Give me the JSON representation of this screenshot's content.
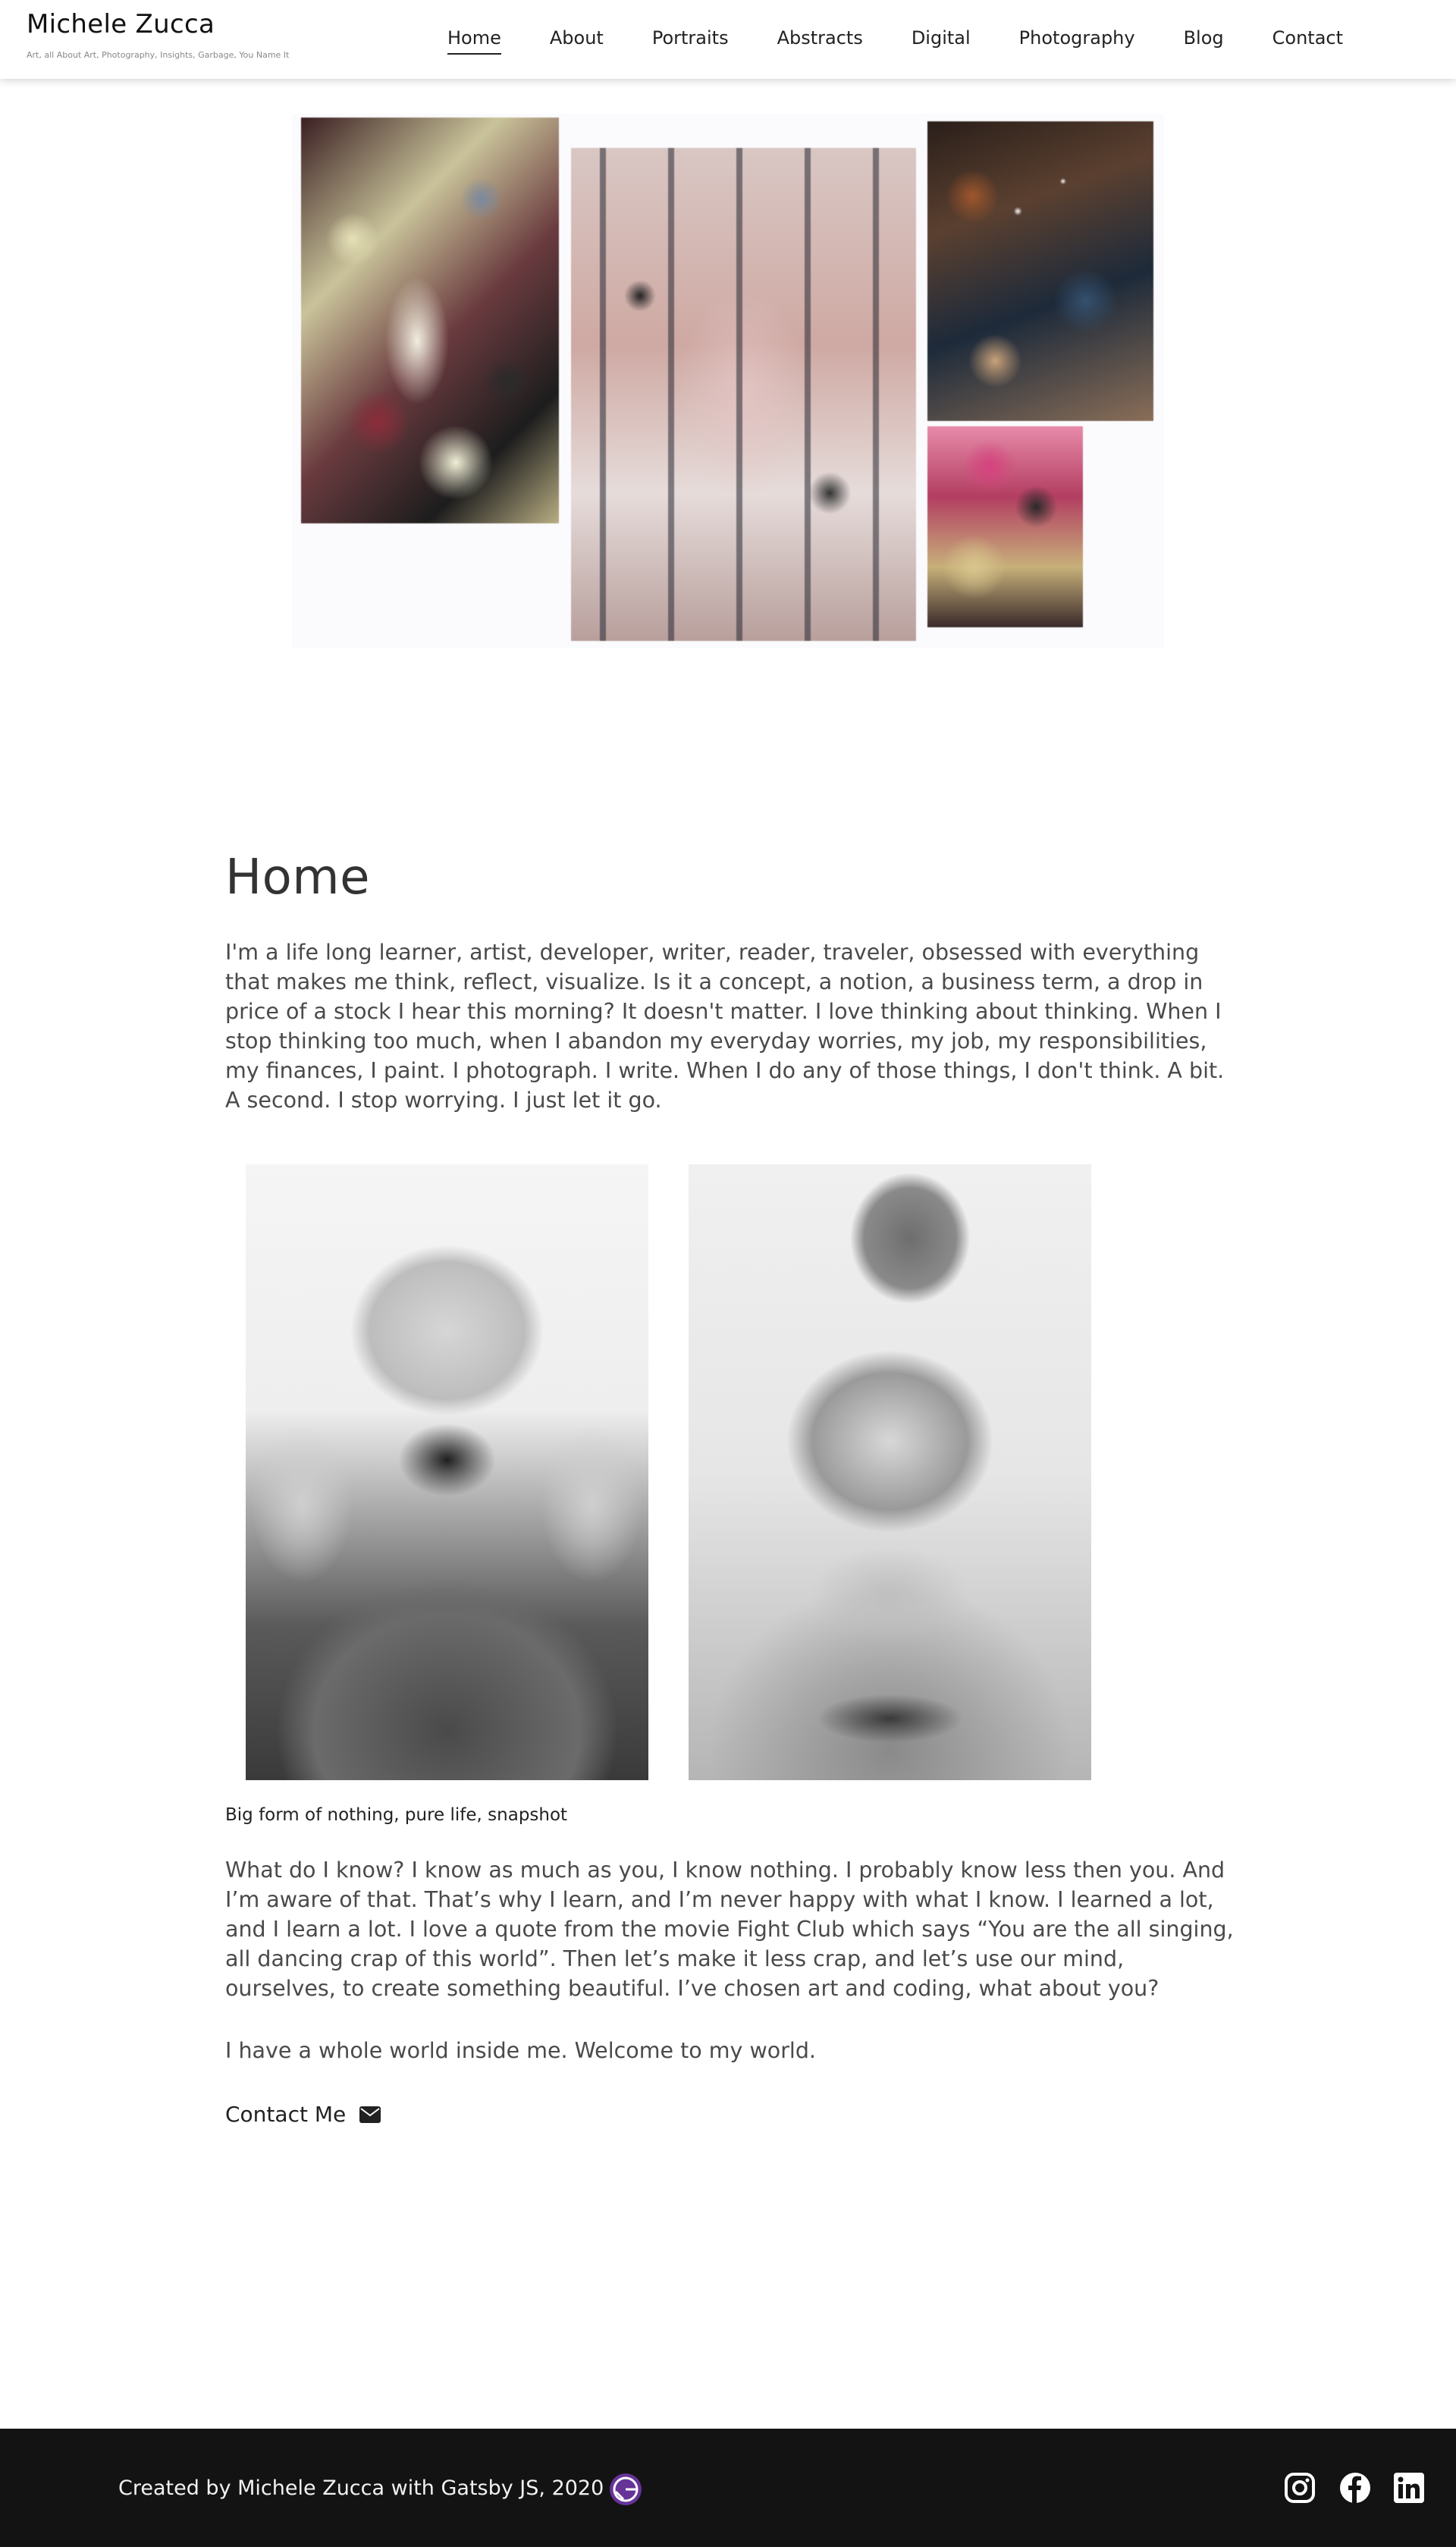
{
  "site": {
    "title": "Michele Zucca",
    "tagline": "Art, all About Art, Photography, Insights, Garbage, You Name It"
  },
  "nav": {
    "items": [
      {
        "label": "Home",
        "active": true
      },
      {
        "label": "About",
        "active": false
      },
      {
        "label": "Portraits",
        "active": false
      },
      {
        "label": "Abstracts",
        "active": false
      },
      {
        "label": "Digital",
        "active": false
      },
      {
        "label": "Photography",
        "active": false
      },
      {
        "label": "Blog",
        "active": false
      },
      {
        "label": "Contact",
        "active": false
      }
    ]
  },
  "main": {
    "title": "Home",
    "intro": "I'm a life long learner, artist, developer, writer, reader, traveler, obsessed with everything that makes me think, reflect, visualize. Is it a concept, a notion, a business term, a drop in price of a stock I hear this morning? It doesn't matter. I love thinking about thinking. When I stop thinking too much, when I abandon my everyday worries, my job, my responsibilities, my finances, I paint. I photograph. I write. When I do any of those things, I don't think. A bit. A second. I stop worrying. I just let it go.",
    "photo_caption": "Big form of nothing, pure life, snapshot",
    "body": "What do I know? I know as much as you, I know nothing. I probably know less then you. And I’m aware of that. That’s why I learn, and I’m never happy with what I know. I learned a lot, and I learn a lot. I love a quote from the movie Fight Club which says “You are the all singing, all dancing crap of this world”. Then let’s make it less crap, and let’s use our mind, ourselves, to create something beautiful. I’ve chosen art and coding, what about you?",
    "closing": "I have a whole world inside me. Welcome to my world.",
    "contact_label": "Contact Me"
  },
  "footer": {
    "credit": "Created by Michele Zucca with Gatsby JS, 2020"
  },
  "icons": {
    "mail": "envelope-icon",
    "gatsby": "gatsby-logo-icon",
    "instagram": "instagram-icon",
    "facebook": "facebook-icon",
    "linkedin": "linkedin-icon"
  },
  "colors": {
    "footer_bg": "#131313",
    "gatsby_purple": "#663399",
    "text": "#4a4a4a"
  }
}
